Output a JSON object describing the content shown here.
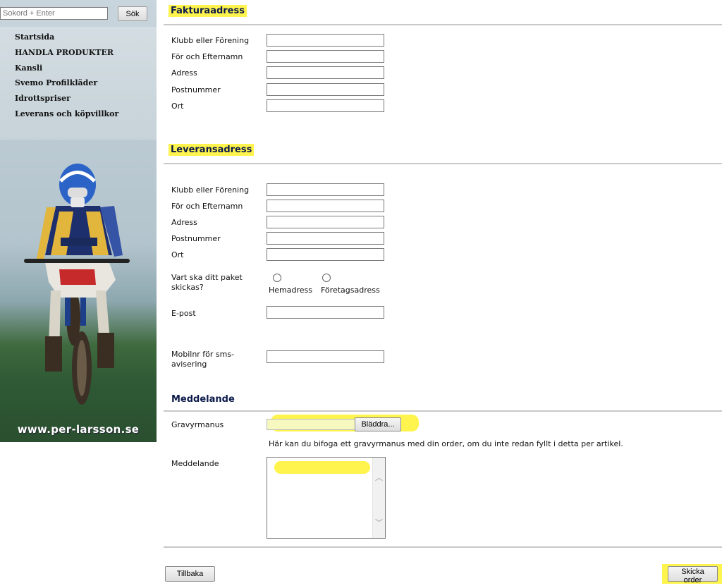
{
  "sidebar": {
    "search_placeholder": "Sokord + Enter",
    "search_button": "Sök",
    "nav": [
      "Startsida",
      "HANDLA PRODUKTER",
      "Kansli",
      "Svemo Profilkläder",
      "Idrottspriser",
      "Leverans och köpvillkor"
    ],
    "watermark": "www.per-larsson.se"
  },
  "billing": {
    "title": "Fakturaadress",
    "fields": [
      "Klubb eller Förening",
      "För och Efternamn",
      "Adress",
      "Postnummer",
      "Ort"
    ]
  },
  "delivery": {
    "title": "Leveransadress",
    "fields": [
      "Klubb eller Förening",
      "För och Efternamn",
      "Adress",
      "Postnummer",
      "Ort"
    ],
    "ship_question": "Vart ska ditt paket skickas?",
    "radio_home": "Hemadress",
    "radio_company": "Företagsadress",
    "email_label": "E-post",
    "mobile_label": "Mobilnr för sms-avisering"
  },
  "message": {
    "title": "Meddelande",
    "engraving_label": "Gravyrmanus",
    "browse_button": "Bläddra...",
    "engraving_hint": "Här kan du bifoga ett gravyrmanus med din order, om du inte redan fyllt i detta per artikel.",
    "message_label": "Meddelande"
  },
  "actions": {
    "back": "Tillbaka",
    "submit": "Skicka order"
  },
  "colors": {
    "highlight": "#fff34d",
    "heading": "#0b1a4a"
  }
}
